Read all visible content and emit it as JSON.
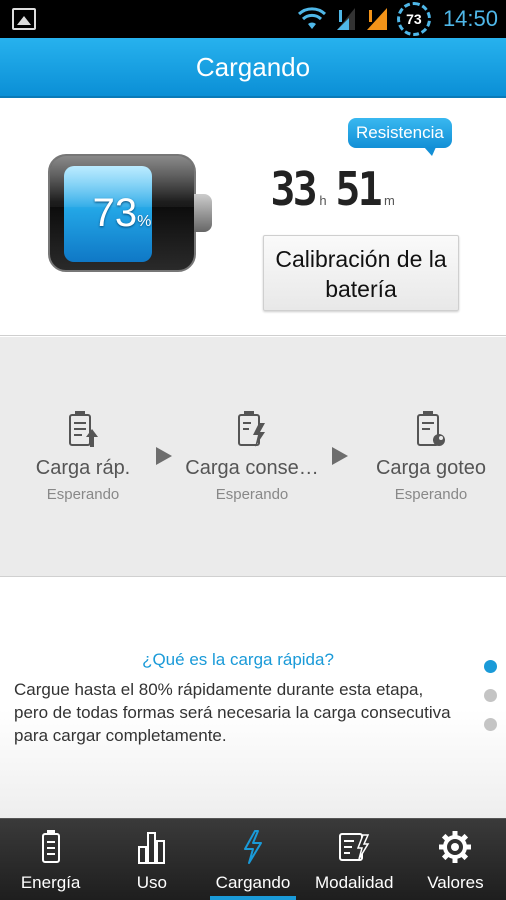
{
  "status_bar": {
    "time": "14:50",
    "battery_level": "73",
    "icons": [
      "image-icon",
      "wifi-icon",
      "signal-icon",
      "signal-icon",
      "battery-icon"
    ]
  },
  "header": {
    "title": "Cargando"
  },
  "battery": {
    "percent_value": "73",
    "percent_sign": "%"
  },
  "resistance": {
    "label": "Resistencia",
    "hours": "33",
    "hours_unit": "h",
    "minutes": "51",
    "minutes_unit": "m"
  },
  "calibrate_button": {
    "label": "Calibración de la batería"
  },
  "stages": [
    {
      "name": "Carga ráp.",
      "status": "Esperando",
      "icon": "fast-charge-icon"
    },
    {
      "name": "Carga conse…",
      "status": "Esperando",
      "icon": "continuous-charge-icon"
    },
    {
      "name": "Carga goteo",
      "status": "Esperando",
      "icon": "trickle-charge-icon"
    }
  ],
  "info": {
    "title": "¿Qué es la carga rápida?",
    "text": "Cargue hasta el 80% rápidamente durante esta etapa, pero de todas formas será necesaria la carga consecutiva para cargar completamente.",
    "pages": 3,
    "active_page": 1
  },
  "bottom_nav": [
    {
      "label": "Energía",
      "icon": "battery-icon",
      "active": false
    },
    {
      "label": "Uso",
      "icon": "bar-chart-icon",
      "active": false
    },
    {
      "label": "Cargando",
      "icon": "lightning-icon",
      "active": true
    },
    {
      "label": "Modalidad",
      "icon": "mode-list-icon",
      "active": false
    },
    {
      "label": "Valores",
      "icon": "gear-icon",
      "active": false
    }
  ],
  "colors": {
    "accent": "#1a9ad8",
    "titlebar": "#1ba3e4",
    "status_time": "#4fb7e8"
  }
}
